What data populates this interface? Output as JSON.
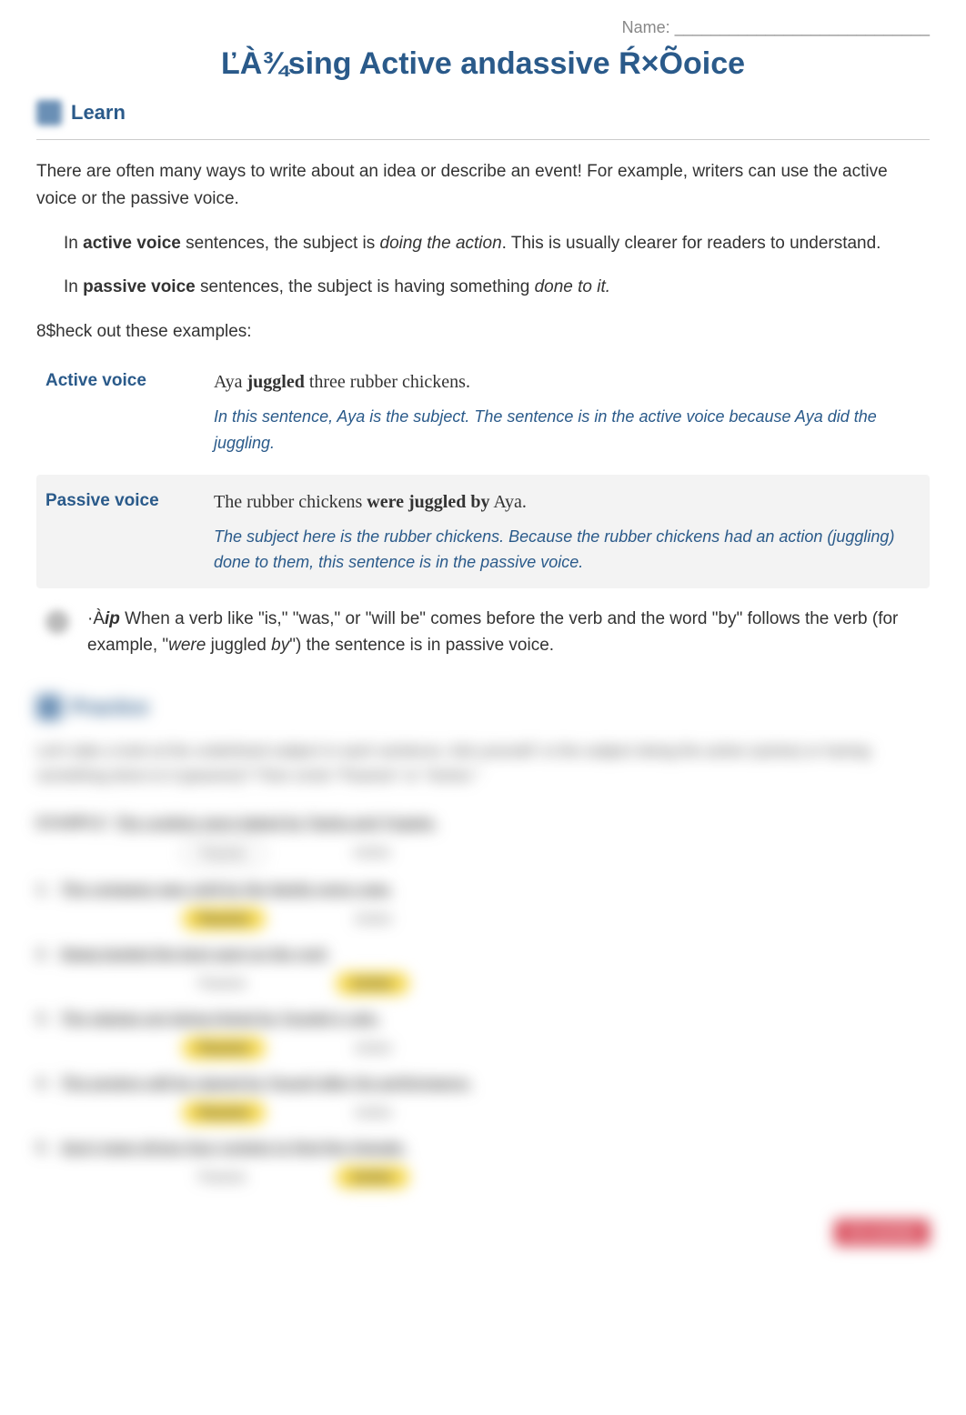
{
  "name_label": "Name: ____________________________",
  "title": "ĽÀ¾sing Active andassive Ŕ×Õoice",
  "learn_label": "Learn",
  "intro": "There are often many ways to write about an idea or describe an event! For example, writers can use the active voice or the passive voice.",
  "active_def_pre": "In ",
  "active_def_bold": "active voice",
  "active_def_mid": " sentences, the subject is ",
  "active_def_italic": "doing the action",
  "active_def_post": ". This is usually clearer for readers to understand.",
  "passive_def_pre": "In ",
  "passive_def_bold": "passive voice",
  "passive_def_mid": " sentences, the subject is having something ",
  "passive_def_italic": "done to it.",
  "examples_intro": "8$heck out these examples:",
  "ex_active_label": "Active voice",
  "ex_active_sentence_a": "Aya ",
  "ex_active_sentence_b": "juggled",
  "ex_active_sentence_c": " three rubber chickens.",
  "ex_active_note": "In this sentence, Aya is the subject. The sentence is in the active voice because Aya did the juggling.",
  "ex_passive_label": "Passive voice",
  "ex_passive_sentence_a": "The rubber chickens ",
  "ex_passive_sentence_b": "were juggled by",
  "ex_passive_sentence_c": " Aya.",
  "ex_passive_note": "The subject here is the rubber chickens. Because the rubber chickens had an action (juggling) done to them, this sentence is in the passive voice.",
  "tip_prefix": "·À",
  "tip_label": "ip",
  "tip_text_a": " When a verb like \"is,\" \"was,\" or \"will be\" comes before the verb and the word \"by\" follows the verb (for example, \"",
  "tip_text_b": "were",
  "tip_text_c": " juggled ",
  "tip_text_d": "by",
  "tip_text_e": "\") the sentence is in passive voice.",
  "practice_label": "Practice",
  "blur_instructions": "Let's take a look at the underlined subject in each sentence. Ask yourself: Is the subject doing the action (active) or having something done to it (passive)? Then circle \"Passive\" or \"Active.\"",
  "blur_example_label": "EXAMPLE",
  "blur_example_sentence": "The cookies were baked by Tasha and Yngwie.",
  "blur_rows": [
    {
      "n": "1.",
      "sentence": "The company was sold by the family every year.",
      "answer": "passive"
    },
    {
      "n": "2.",
      "sentence": "Dawg landed the best spot on the roof.",
      "answer": "active"
    },
    {
      "n": "3.",
      "sentence": "The stamps are being licked by Yusuke's cats.",
      "answer": "passive"
    },
    {
      "n": "4.",
      "sentence": "The posters will be signed by Yousef after his performance.",
      "answer": "passive"
    },
    {
      "n": "5.",
      "sentence": "Aya's team drives four rockets to find the triangle.",
      "answer": "active"
    }
  ],
  "choice_passive": "Passive",
  "choice_active": "Active",
  "footer": "ixl.com/ela"
}
